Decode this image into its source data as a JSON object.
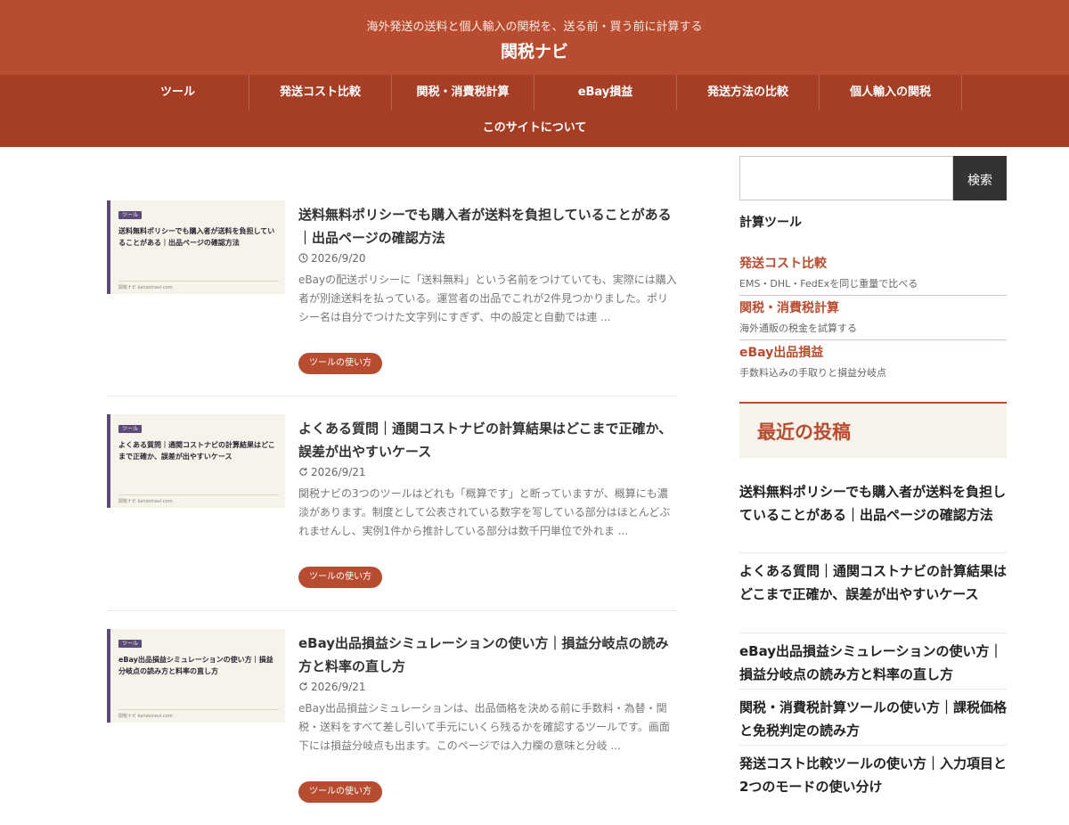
{
  "header": {
    "tagline": "海外発送の送料と個人輸入の関税を、送る前・買う前に計算する",
    "site_title": "関税ナビ"
  },
  "nav": {
    "items": [
      {
        "label": "ツール"
      },
      {
        "label": "発送コスト比較"
      },
      {
        "label": "関税・消費税計算"
      },
      {
        "label": "eBay損益"
      },
      {
        "label": "発送方法の比較"
      },
      {
        "label": "個人輸入の関税"
      },
      {
        "label": "このサイトについて"
      }
    ]
  },
  "posts": [
    {
      "title": "送料無料ポリシーでも購入者が送料を負担していることがある｜出品ページの確認方法",
      "date": "2026/9/20",
      "date_icon": "clock-icon",
      "excerpt": "eBayの配送ポリシーに「送料無料」という名前をつけていても、実際には購入者が別途送料を払っている。運営者の出品でこれが2件見つかりました。ポリシー名は自分でつけた文字列にすぎず、中の設定と自動では連 ...",
      "category": "ツールの使い方",
      "thumb_tag": "ツール",
      "thumb_title": "送料無料ポリシーでも購入者が送料を負担していることがある｜出品ページの確認方法",
      "thumb_footer": "関税ナビ kanzeinavi.com"
    },
    {
      "title": "よくある質問｜通関コストナビの計算結果はどこまで正確か、誤差が出やすいケース",
      "date": "2026/9/21",
      "date_icon": "refresh-icon",
      "excerpt": "関税ナビの3つのツールはどれも「概算です」と断っていますが、概算にも濃淡があります。制度として公表されている数字を写している部分はほとんどぶれませんし、実例1件から推計している部分は数千円単位で外れま ...",
      "category": "ツールの使い方",
      "thumb_tag": "ツール",
      "thumb_title": "よくある質問｜通関コストナビの計算結果はどこまで正確か、誤差が出やすいケース",
      "thumb_footer": "関税ナビ kanzeinavi.com"
    },
    {
      "title": "eBay出品損益シミュレーションの使い方｜損益分岐点の読み方と料率の直し方",
      "date": "2026/9/21",
      "date_icon": "refresh-icon",
      "excerpt": "eBay出品損益シミュレーションは、出品価格を決める前に手数料・為替・関税・送料をすべて差し引いて手元にいくら残るかを確認するツールです。画面下には損益分岐点も出ます。このページでは入力欄の意味と分岐 ...",
      "category": "ツールの使い方",
      "thumb_tag": "ツール",
      "thumb_title": "eBay出品損益シミュレーションの使い方｜損益分岐点の読み方と料率の直し方",
      "thumb_footer": "関税ナビ kanzeinavi.com"
    }
  ],
  "sidebar": {
    "search": {
      "placeholder": "",
      "button_label": "検索"
    },
    "tools_title": "計算ツール",
    "tools": [
      {
        "name": "発送コスト比較",
        "desc": "EMS・DHL・FedExを同じ重量で比べる"
      },
      {
        "name": "関税・消費税計算",
        "desc": "海外通販の税金を試算する"
      },
      {
        "name": "eBay出品損益",
        "desc": "手数料込みの手取りと損益分岐点"
      }
    ],
    "recent_title": "最近の投稿",
    "recent": [
      {
        "title": "送料無料ポリシーでも購入者が送料を負担していることがある｜出品ページの確認方法"
      },
      {
        "title": "よくある質問｜通関コストナビの計算結果はどこまで正確か、誤差が出やすいケース"
      },
      {
        "title": "eBay出品損益シミュレーションの使い方｜損益分岐点の読み方と料率の直し方"
      },
      {
        "title": "関税・消費税計算ツールの使い方｜課税価格と免税判定の読み方"
      },
      {
        "title": "発送コスト比較ツールの使い方｜入力項目と2つのモードの使い分け"
      }
    ]
  },
  "colors": {
    "header_bg": "#b84c30",
    "nav_bg": "#a63e26",
    "accent": "#b84c30",
    "thumb_accent": "#5d4a78"
  }
}
